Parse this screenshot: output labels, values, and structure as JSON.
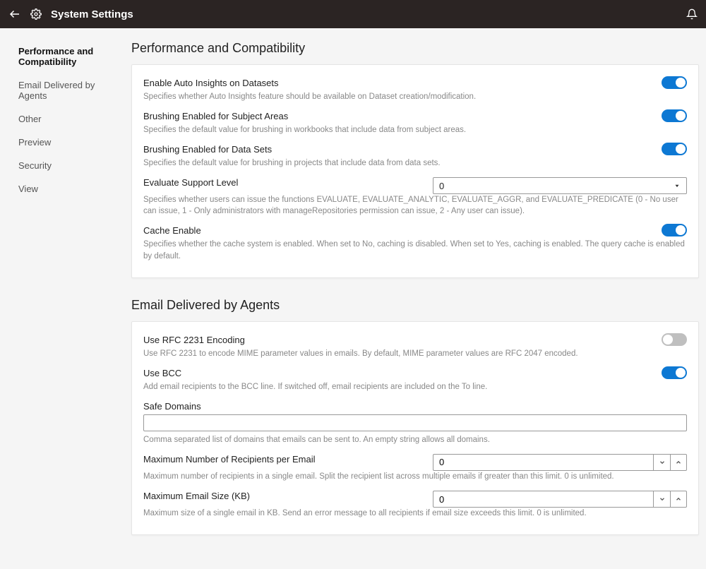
{
  "header": {
    "title": "System Settings"
  },
  "sidebar": {
    "items": [
      {
        "label": "Performance and Compatibility",
        "active": true
      },
      {
        "label": "Email Delivered by Agents",
        "active": false
      },
      {
        "label": "Other",
        "active": false
      },
      {
        "label": "Preview",
        "active": false
      },
      {
        "label": "Security",
        "active": false
      },
      {
        "label": "View",
        "active": false
      }
    ]
  },
  "sections": {
    "perf": {
      "title": "Performance and Compatibility",
      "settings": {
        "auto_insights": {
          "label": "Enable Auto Insights on Datasets",
          "desc": "Specifies whether Auto Insights feature should be available on Dataset creation/modification.",
          "value": true
        },
        "brushing_subject": {
          "label": "Brushing Enabled for Subject Areas",
          "desc": "Specifies the default value for brushing in workbooks that include data from subject areas.",
          "value": true
        },
        "brushing_datasets": {
          "label": "Brushing Enabled for Data Sets",
          "desc": "Specifies the default value for brushing in projects that include data from data sets.",
          "value": true
        },
        "evaluate_support": {
          "label": "Evaluate Support Level",
          "desc": "Specifies whether users can issue the functions EVALUATE, EVALUATE_ANALYTIC, EVALUATE_AGGR, and EVALUATE_PREDICATE (0 - No user can issue, 1 - Only administrators with manageRepositories permission can issue, 2 - Any user can issue).",
          "value": "0"
        },
        "cache_enable": {
          "label": "Cache Enable",
          "desc": "Specifies whether the cache system is enabled. When set to No, caching is disabled. When set to Yes, caching is enabled. The query cache is enabled by default.",
          "value": true
        }
      }
    },
    "email": {
      "title": "Email Delivered by Agents",
      "settings": {
        "rfc2231": {
          "label": "Use RFC 2231 Encoding",
          "desc": "Use RFC 2231 to encode MIME parameter values in emails. By default, MIME parameter values are RFC 2047 encoded.",
          "value": false
        },
        "use_bcc": {
          "label": "Use BCC",
          "desc": "Add email recipients to the BCC line. If switched off, email recipients are included on the To line.",
          "value": true
        },
        "safe_domains": {
          "label": "Safe Domains",
          "desc": "Comma separated list of domains that emails can be sent to. An empty string allows all domains.",
          "value": ""
        },
        "max_recipients": {
          "label": "Maximum Number of Recipients per Email",
          "desc": "Maximum number of recipients in a single email. Split the recipient list across multiple emails if greater than this limit. 0 is unlimited.",
          "value": "0"
        },
        "max_email_size": {
          "label": "Maximum Email Size (KB)",
          "desc": "Maximum size of a single email in KB. Send an error message to all recipients if email size exceeds this limit. 0 is unlimited.",
          "value": "0"
        }
      }
    }
  }
}
